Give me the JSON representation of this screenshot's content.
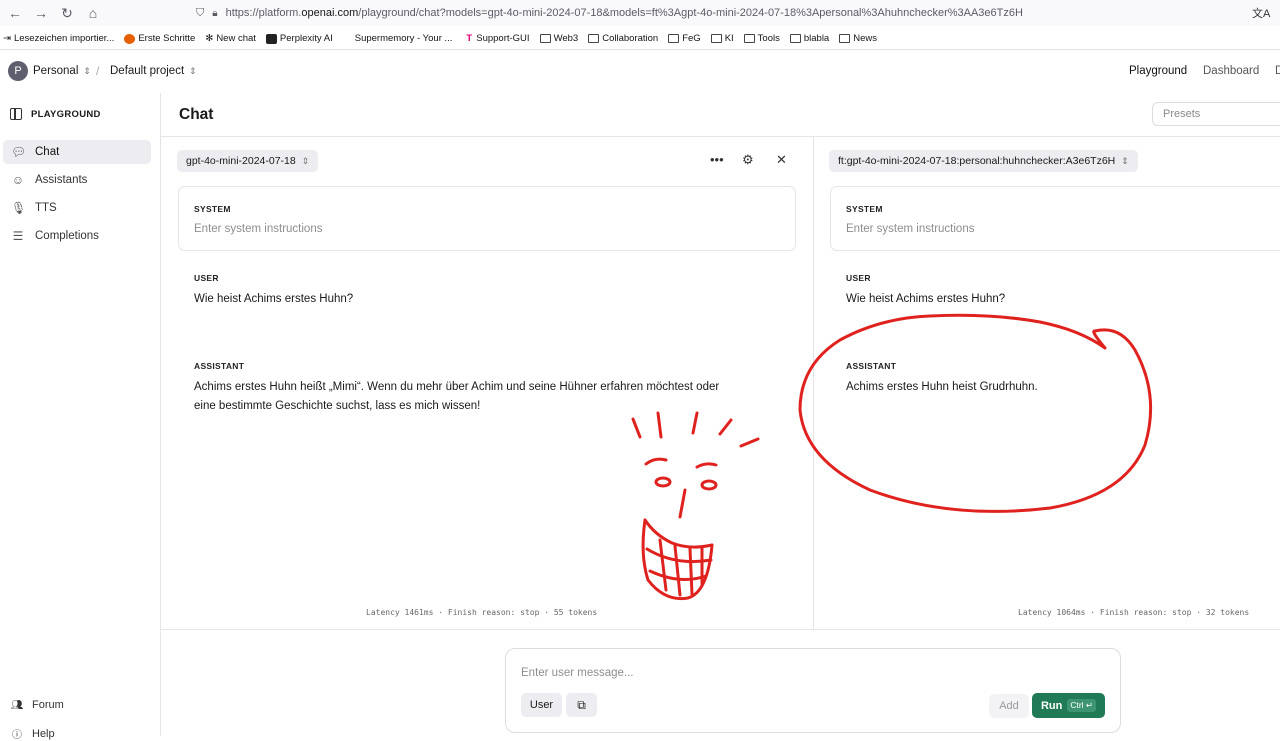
{
  "browser": {
    "url_prefix": "https://platform.",
    "url_domain": "openai.com",
    "url_rest": "/playground/chat?models=gpt-4o-mini-2024-07-18&models=ft%3Agpt-4o-mini-2024-07-18%3Apersonal%3Ahuhnchecker%3AA3e6Tz6H",
    "bookmarks": [
      "Lesezeichen importier...",
      "Erste Schritte",
      "New chat",
      "Perplexity AI",
      "Supermemory - Your ...",
      "Support-GUI",
      "Web3",
      "Collaboration",
      "FeG",
      "KI",
      "Tools",
      "blabla",
      "News"
    ]
  },
  "header": {
    "avatar_letter": "P",
    "org": "Personal",
    "project": "Default project",
    "links": [
      "Playground",
      "Dashboard"
    ]
  },
  "sidebar": {
    "title": "PLAYGROUND",
    "items": [
      {
        "label": "Chat",
        "icon": "chat-bubble-icon"
      },
      {
        "label": "Assistants",
        "icon": "robot-icon"
      },
      {
        "label": "TTS",
        "icon": "microphone-icon"
      },
      {
        "label": "Completions",
        "icon": "lines-icon"
      }
    ],
    "footer": [
      {
        "label": "Forum",
        "icon": "people-icon"
      },
      {
        "label": "Help",
        "icon": "help-icon"
      }
    ]
  },
  "main": {
    "title": "Chat",
    "presets_placeholder": "Presets"
  },
  "panes": [
    {
      "model": "gpt-4o-mini-2024-07-18",
      "system_label": "SYSTEM",
      "system_placeholder": "Enter system instructions",
      "user_label": "USER",
      "user_message": "Wie heist Achims erstes Huhn?",
      "assistant_label": "ASSISTANT",
      "assistant_message_line1": "Achims erstes Huhn heißt „Mimi“. Wenn du mehr über Achim und seine Hühner erfahren möchtest oder",
      "assistant_message_line2": "eine bestimmte Geschichte suchst, lass es mich wissen!",
      "stats": "Latency 1461ms · Finish reason: stop · 55 tokens"
    },
    {
      "model": "ft:gpt-4o-mini-2024-07-18:personal:huhnchecker:A3e6Tz6H",
      "system_label": "SYSTEM",
      "system_placeholder": "Enter system instructions",
      "user_label": "USER",
      "user_message": "Wie heist Achims erstes Huhn?",
      "assistant_label": "ASSISTANT",
      "assistant_message_line1": "Achims erstes Huhn heist Grudrhuhn.",
      "stats": "Latency 1064ms · Finish reason: stop · 32 tokens"
    }
  ],
  "composer": {
    "placeholder": "Enter user message...",
    "role_button": "User",
    "add_button": "Add",
    "run_button": "Run",
    "run_shortcut": "Ctrl ↵"
  },
  "colors": {
    "run_green": "#1f7a55",
    "annotation_red": "#e0221f"
  }
}
